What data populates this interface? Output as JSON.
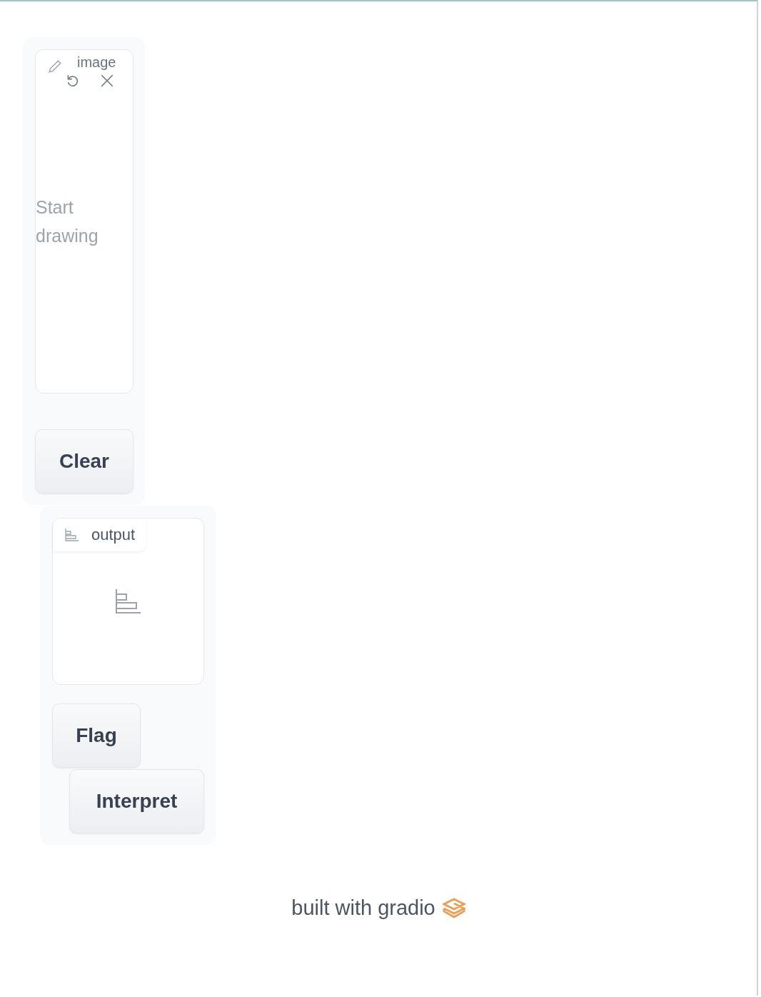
{
  "input_panel": {
    "label": "image",
    "placeholder": "Start drawing",
    "buttons": [
      "Clear"
    ]
  },
  "output_panel": {
    "label": "output",
    "buttons": [
      "Flag",
      "Interpret"
    ]
  },
  "footer": {
    "text": "built with gradio"
  }
}
